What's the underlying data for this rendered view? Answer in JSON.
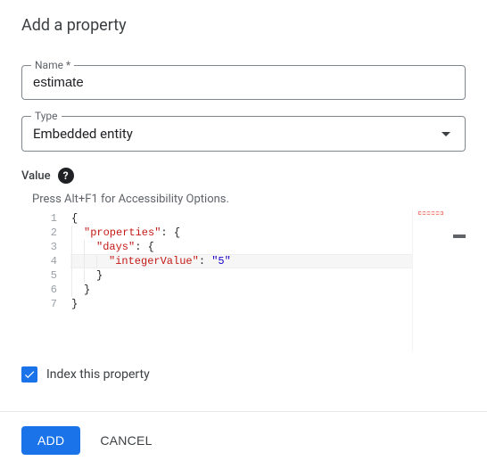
{
  "dialog": {
    "title": "Add a property"
  },
  "name_field": {
    "label": "Name *",
    "value": "estimate"
  },
  "type_field": {
    "label": "Type",
    "selected": "Embedded entity"
  },
  "value_section": {
    "label": "Value",
    "a11y_hint": "Press Alt+F1 for Accessibility Options.",
    "line_numbers": [
      "1",
      "2",
      "3",
      "4",
      "5",
      "6",
      "7"
    ],
    "code": {
      "key_properties": "\"properties\"",
      "key_days": "\"days\"",
      "key_integerValue": "\"integerValue\"",
      "val_five": "\"5\""
    },
    "raw_json": "{\n  \"properties\": {\n    \"days\": {\n      \"integerValue\": \"5\"\n    }\n  }\n}"
  },
  "index_checkbox": {
    "label": "Index this property",
    "checked": true
  },
  "actions": {
    "add": "ADD",
    "cancel": "CANCEL"
  }
}
